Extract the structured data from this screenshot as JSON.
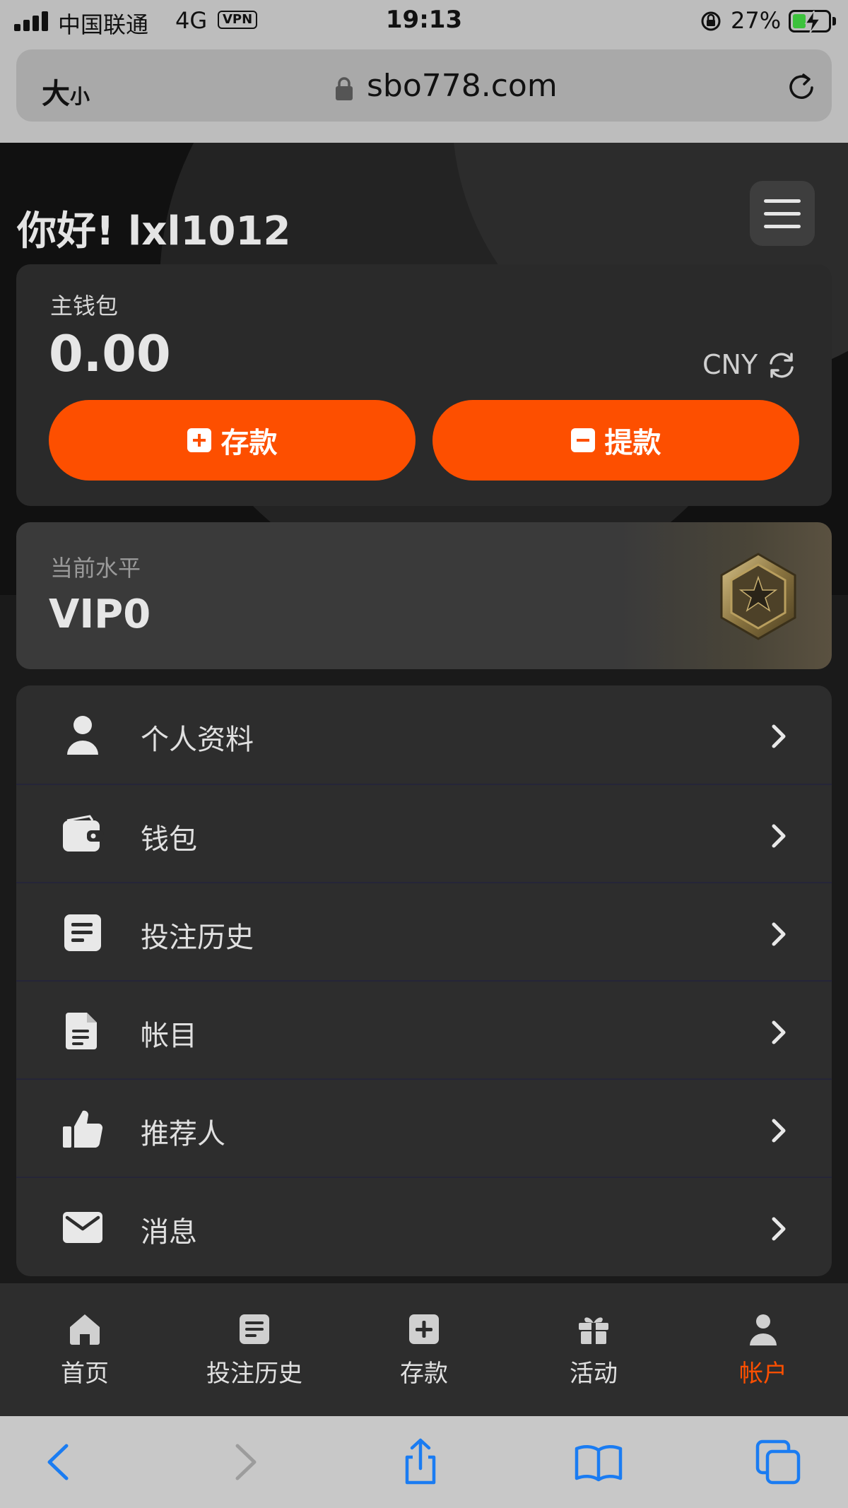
{
  "status_bar": {
    "carrier": "中国联通",
    "network": "4G",
    "vpn": "VPN",
    "time": "19:13",
    "battery": "27%"
  },
  "browser": {
    "text_size": "大",
    "text_size_small": "小",
    "url": "sbo778.com"
  },
  "header": {
    "greeting": "你好! lxl1012"
  },
  "wallet": {
    "label": "主钱包",
    "balance": "0.00",
    "currency": "CNY",
    "deposit_label": "存款",
    "withdraw_label": "提款"
  },
  "vip": {
    "label": "当前水平",
    "level": "VIP0"
  },
  "menu": {
    "items": [
      {
        "label": "个人资料",
        "icon": "user-icon"
      },
      {
        "label": "钱包",
        "icon": "wallet-icon"
      },
      {
        "label": "投注历史",
        "icon": "list-icon"
      },
      {
        "label": "帐目",
        "icon": "document-icon"
      },
      {
        "label": "推荐人",
        "icon": "thumbs-up-icon"
      },
      {
        "label": "消息",
        "icon": "envelope-icon"
      }
    ]
  },
  "tabbar": {
    "items": [
      {
        "label": "首页",
        "icon": "home-icon"
      },
      {
        "label": "投注历史",
        "icon": "list-icon"
      },
      {
        "label": "存款",
        "icon": "plus-square-icon"
      },
      {
        "label": "活动",
        "icon": "gift-icon"
      },
      {
        "label": "帐户",
        "icon": "user-icon"
      }
    ],
    "active_color": "#fd4f00"
  },
  "colors": {
    "accent": "#fd4f00",
    "background": "#1a1a1a",
    "card": "#2d2d2d"
  }
}
